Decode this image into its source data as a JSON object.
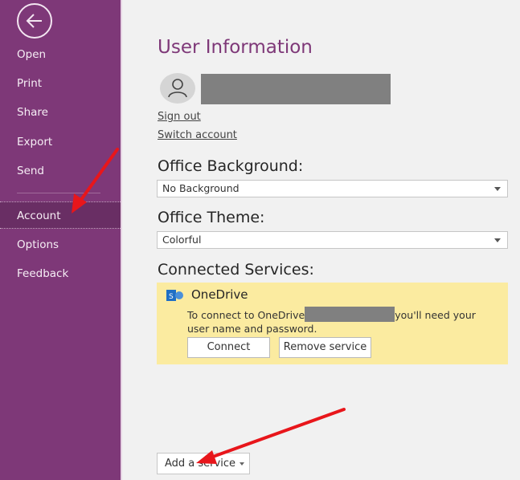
{
  "sidebar": {
    "back_label": "Back",
    "items": [
      {
        "label": "Open"
      },
      {
        "label": "Print"
      },
      {
        "label": "Share"
      },
      {
        "label": "Export"
      },
      {
        "label": "Send"
      },
      {
        "label": "Account",
        "active": true
      },
      {
        "label": "Options"
      },
      {
        "label": "Feedback"
      }
    ]
  },
  "user_info": {
    "title": "User Information",
    "user_name": "[redacted]",
    "sign_out": "Sign out",
    "switch_account": "Switch account"
  },
  "office_background": {
    "label": "Office Background:",
    "selected": "No Background"
  },
  "office_theme": {
    "label": "Office Theme:",
    "selected": "Colorful"
  },
  "connected_services": {
    "label": "Connected Services:",
    "services": [
      {
        "name": "OneDrive",
        "description_prefix": "To connect to OneDrive",
        "description_redacted": "[redacted]",
        "description_suffix": "you'll need your user name and password.",
        "connect_label": "Connect",
        "remove_label": "Remove service"
      }
    ],
    "add_service_label": "Add a service"
  },
  "colors": {
    "sidebar": "#7e3878",
    "accent_title": "#7e3878",
    "service_card": "#fbeba0",
    "annotation_arrow": "#e8161b"
  },
  "annotations": [
    {
      "type": "arrow",
      "target": "Account"
    },
    {
      "type": "arrow",
      "target": "Add a service"
    }
  ]
}
